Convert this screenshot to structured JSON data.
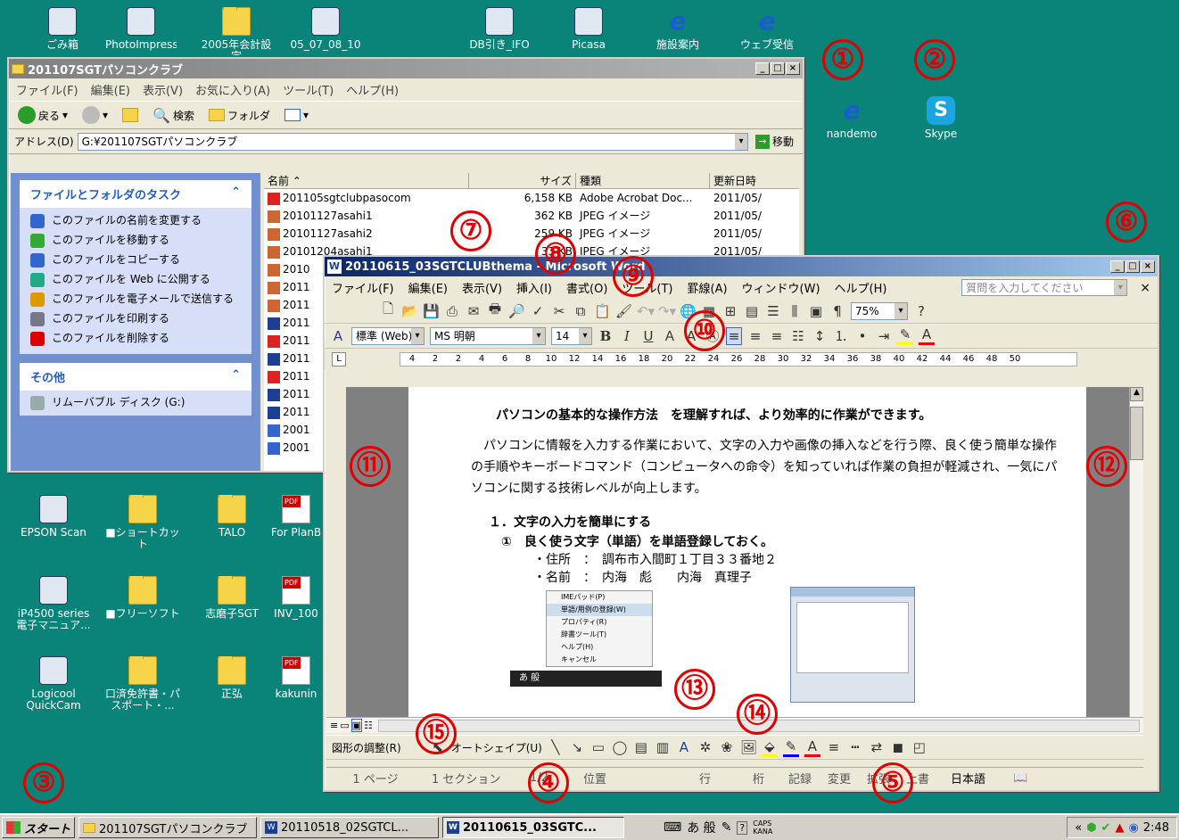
{
  "desktop": {
    "top_icons": [
      {
        "label": "ごみ箱",
        "icon": "recycle-bin-icon"
      },
      {
        "label": "PhotoImpression",
        "icon": "app-shortcut-icon"
      },
      {
        "label": "2005年会計設定",
        "icon": "folder-icon"
      },
      {
        "label": "05_07_08_10",
        "icon": "3gpp-file-icon"
      },
      {
        "label": "DB引き_IFO",
        "icon": "excel-icon"
      },
      {
        "label": "Picasa",
        "icon": "picasa-icon"
      },
      {
        "label": "施設案内",
        "icon": "ie-shortcut-icon"
      },
      {
        "label": "ウェブ受信",
        "icon": "ie-shortcut-icon"
      }
    ],
    "right_icons": [
      {
        "label": "nandemo",
        "icon": "ie-icon"
      },
      {
        "label": "Skype",
        "icon": "skype-icon"
      }
    ],
    "left_icons": [
      {
        "label": "EPSON Scan",
        "icon": "scanner-icon"
      },
      {
        "label": "■ショートカット",
        "icon": "folder-icon"
      },
      {
        "label": "TALO",
        "icon": "folder-icon"
      },
      {
        "label": "For PlanB",
        "icon": "pdf-icon"
      },
      {
        "label": "iP4500 series 電子マニュア...",
        "icon": "printer-icon"
      },
      {
        "label": "■フリーソフト",
        "icon": "folder-icon"
      },
      {
        "label": "志磨子SGT",
        "icon": "folder-icon"
      },
      {
        "label": "INV_100",
        "icon": "pdf-icon"
      },
      {
        "label": "Logicool QuickCam",
        "icon": "webcam-icon"
      },
      {
        "label": "口済免許書・パスポート・...",
        "icon": "folder-icon"
      },
      {
        "label": "正弘",
        "icon": "folder-icon"
      },
      {
        "label": "kakunin",
        "icon": "pdf-icon"
      }
    ]
  },
  "markers": [
    "①",
    "②",
    "③",
    "④",
    "⑤",
    "⑥",
    "⑦",
    "⑧",
    "⑨",
    "⑩",
    "⑪",
    "⑫",
    "⑬",
    "⑭",
    "⑮"
  ],
  "explorer": {
    "title": "201107SGTパソコンクラブ",
    "menu": [
      "ファイル(F)",
      "編集(E)",
      "表示(V)",
      "お気に入り(A)",
      "ツール(T)",
      "ヘルプ(H)"
    ],
    "toolbar": {
      "back": "戻る",
      "search": "検索",
      "folders": "フォルダ"
    },
    "address_label": "アドレス(D)",
    "address_value": "G:¥201107SGTパソコンクラブ",
    "go_label": "移動",
    "tasks_title": "ファイルとフォルダのタスク",
    "tasks": [
      "このファイルの名前を変更する",
      "このファイルを移動する",
      "このファイルをコピーする",
      "このファイルを Web に公開する",
      "このファイルを電子メールで送信する",
      "このファイルを印刷する",
      "このファイルを削除する"
    ],
    "other_title": "その他",
    "other_items": [
      "リムーバブル ディスク (G:)"
    ],
    "columns": [
      "名前",
      "サイズ",
      "種類",
      "更新日時"
    ],
    "files": [
      {
        "name": "201105sgtclubpasocom",
        "size": "6,158 KB",
        "type": "Adobe Acrobat Doc...",
        "date": "2011/05/",
        "kind": "pdf"
      },
      {
        "name": "20101127asahi1",
        "size": "362 KB",
        "type": "JPEG イメージ",
        "date": "2011/05/",
        "kind": "jpg"
      },
      {
        "name": "20101127asahi2",
        "size": "259 KB",
        "type": "JPEG イメージ",
        "date": "2011/05/",
        "kind": "jpg"
      },
      {
        "name": "20101204asahi1",
        "size": "33 KB",
        "type": "JPEG イメージ",
        "date": "2011/05/",
        "kind": "jpg"
      },
      {
        "name": "2010",
        "size": "",
        "type": "",
        "date": "",
        "kind": "jpg"
      },
      {
        "name": "2011",
        "size": "",
        "type": "",
        "date": "",
        "kind": "jpg"
      },
      {
        "name": "2011",
        "size": "",
        "type": "",
        "date": "",
        "kind": "jpg"
      },
      {
        "name": "2011",
        "size": "",
        "type": "",
        "date": "",
        "kind": "doc"
      },
      {
        "name": "2011",
        "size": "",
        "type": "",
        "date": "",
        "kind": "pdf"
      },
      {
        "name": "2011",
        "size": "",
        "type": "",
        "date": "",
        "kind": "doc"
      },
      {
        "name": "2011",
        "size": "",
        "type": "",
        "date": "",
        "kind": "pdf"
      },
      {
        "name": "2011",
        "size": "",
        "type": "",
        "date": "",
        "kind": "doc"
      },
      {
        "name": "2011",
        "size": "",
        "type": "",
        "date": "",
        "kind": "doc"
      },
      {
        "name": "2001",
        "size": "",
        "type": "",
        "date": "",
        "kind": "ie"
      },
      {
        "name": "2001",
        "size": "",
        "type": "",
        "date": "",
        "kind": "ie"
      }
    ]
  },
  "word": {
    "title": "20110615_03SGTCLUBthema - Microsoft Word",
    "menu": [
      "ファイル(F)",
      "編集(E)",
      "表示(V)",
      "挿入(I)",
      "書式(O)",
      "ツール(T)",
      "罫線(A)",
      "ウィンドウ(W)",
      "ヘルプ(H)"
    ],
    "help_placeholder": "質問を入力してください",
    "zoom": "75%",
    "style": "標準 (Web)",
    "font": "MS 明朝",
    "font_size": "14",
    "ruler": [
      "4",
      "2",
      "2",
      "4",
      "6",
      "8",
      "10",
      "12",
      "14",
      "16",
      "18",
      "20",
      "22",
      "24",
      "26",
      "28",
      "30",
      "32",
      "34",
      "36",
      "38",
      "40",
      "42",
      "44",
      "46",
      "48",
      "50"
    ],
    "doc": {
      "heading": "パソコンの基本的な操作方法　を理解すれば、より効率的に作業ができます。",
      "para": "　パソコンに情報を入力する作業において、文字の入力や画像の挿入などを行う際、良く使う簡単な操作の手順やキーボードコマンド（コンピュータへの命令）を知っていれば作業の負担が軽減され、一気にパソコンに関する技術レベルが向上します。",
      "section": "１．文字の入力を簡単にする",
      "sub": "①　良く使う文字（単語）を単語登録しておく。",
      "item1": "・住所　：　調布市入間町１丁目３３番地２",
      "item2": "・名前　：　内海　彪　　内海　真理子"
    },
    "ime_menu": [
      "IMEパッド(P)",
      "単語/用例の登録(W)",
      "プロパティ(R)",
      "辞書ツール(T)",
      "ヘルプ(H)",
      "キャンセル"
    ],
    "ime_bar": "あ 般",
    "drawing": {
      "adjust": "図形の調整(R)",
      "autoshape": "オートシェイプ(U)"
    },
    "status": [
      "1 ページ",
      "1 セクション",
      "1/2",
      "位置",
      "行",
      "桁",
      "記録",
      "変更",
      "拡張",
      "上書",
      "日本語"
    ]
  },
  "taskbar": {
    "start": "スタート",
    "buttons": [
      "201107SGTパソコンクラブ",
      "20110518_02SGTCL...",
      "20110615_03SGTC..."
    ],
    "ime": "あ 般",
    "caps": "CAPS",
    "kana": "KANA",
    "clock": "2:48"
  }
}
